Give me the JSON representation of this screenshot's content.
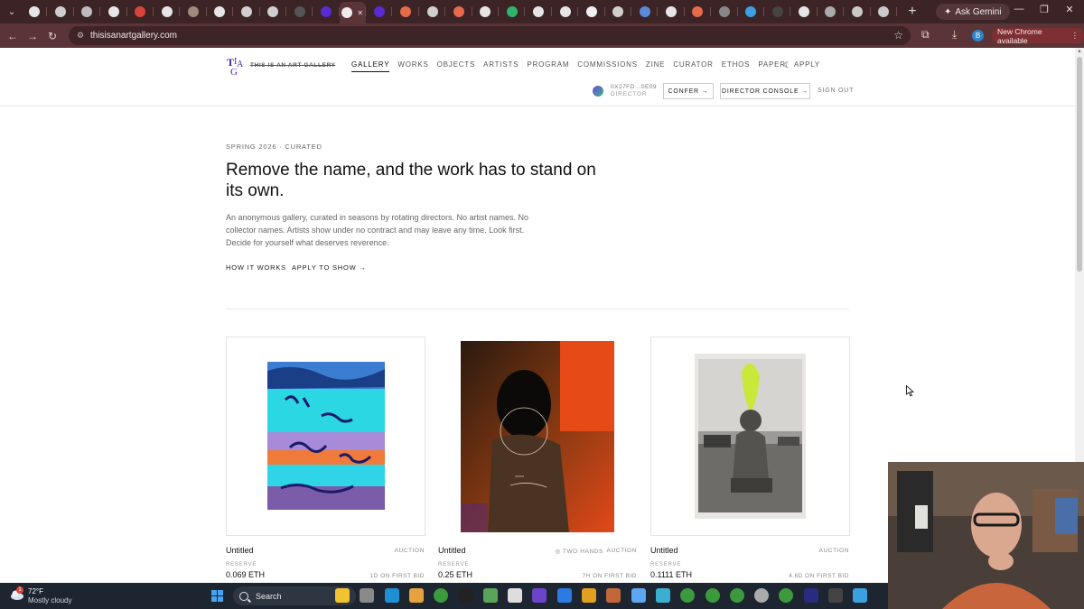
{
  "browser": {
    "tab_favicon_colors": [
      "#e6e6e6",
      "#cfcfcf",
      "#bdbdbd",
      "#e6e6e6",
      "#d44638",
      "#e6e6e6",
      "#a0897f",
      "#e6e6e6",
      "#cfcfcf",
      "#cfcfcf",
      "#555",
      "#5a2bd0",
      "#f2e9ea",
      "#5a2bd0",
      "#e76a4a",
      "#cfcfcf",
      "#e76a4a",
      "#e6e6e6",
      "#2fb36d",
      "#e6e6e6",
      "#e6e6e6",
      "#f0f0f0",
      "#cfcfcf",
      "#5b8ad9",
      "#e6e6e6",
      "#e76a4a",
      "#888",
      "#3aa0e0",
      "#444",
      "#e6e6e6",
      "#aaa",
      "#c9c9c9",
      "#c9c9c9"
    ],
    "ask_gemini": "Ask Gemini",
    "url": "thisisanartgallery.com",
    "profile_initial": "B",
    "update_label": "New Chrome available"
  },
  "site": {
    "logo_text": "THIS IS AN ART GALLERY",
    "nav": [
      "GALLERY",
      "WORKS",
      "OBJECTS",
      "ARTISTS",
      "PROGRAM",
      "COMMISSIONS",
      "ZINE",
      "CURATOR",
      "ETHOS",
      "PAPER",
      "APPLY"
    ],
    "wallet_address": "0X27FD…0E09",
    "wallet_role": "DIRECTOR",
    "confer_label": "CONFER →",
    "console_label": "DIRECTOR CONSOLE →",
    "signout_label": "SIGN OUT"
  },
  "hero": {
    "season": "SPRING 2026 · CURATED",
    "headline": "Remove the name, and the work has to stand on its own.",
    "intro": "An anonymous gallery, curated in seasons by rotating directors. No artist names. No collector names. Artists show under no contract and may leave any time. Look first. Decide for yourself what deserves reverence.",
    "how_it_works": "HOW IT WORKS",
    "apply_to_show": "APPLY TO SHOW →"
  },
  "works": [
    {
      "title": "Untitled",
      "type": "AUCTION",
      "badge": "",
      "reserve_label": "RESERVE",
      "reserve": "0.069 ETH",
      "timer": "1D ON FIRST BID"
    },
    {
      "title": "Untitled",
      "type": "AUCTION",
      "badge": "◎ TWO HANDS",
      "reserve_label": "RESERVE",
      "reserve": "0.25 ETH",
      "timer": "7H ON FIRST BID"
    },
    {
      "title": "Untitled",
      "type": "AUCTION",
      "badge": "",
      "reserve_label": "RESERVE",
      "reserve": "0.1111 ETH",
      "timer": "4.6D ON FIRST BID"
    }
  ],
  "taskbar": {
    "weather_badge": "1",
    "temp": "72°F",
    "condition": "Mostly cloudy",
    "search": "Search"
  }
}
